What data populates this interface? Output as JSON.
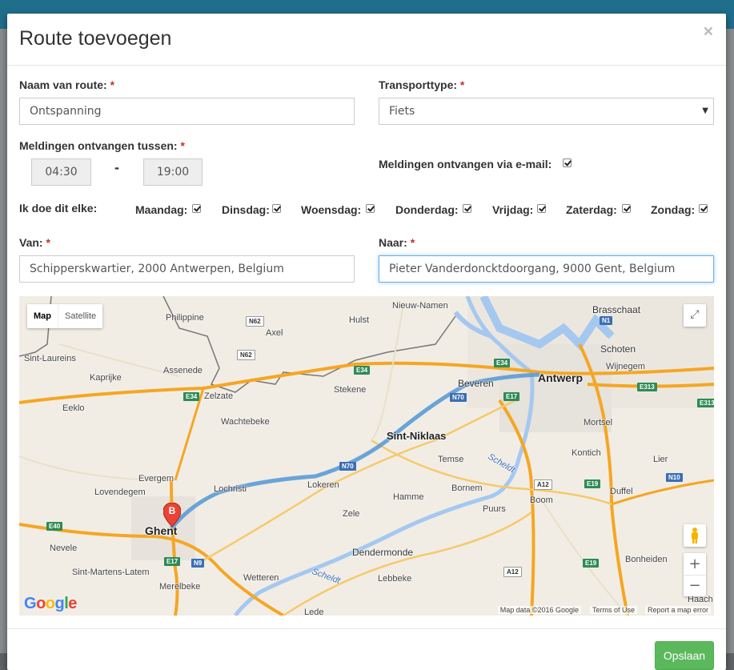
{
  "modal": {
    "title": "Route toevoegen",
    "close": "×"
  },
  "form": {
    "route_name_label": "Naam van route:",
    "route_name_value": "Ontspanning",
    "transport_label": "Transporttype:",
    "transport_value": "Fiets",
    "notif_between_label": "Meldingen ontvangen tussen:",
    "time_from": "04:30",
    "time_separator": "-",
    "time_to": "19:00",
    "notif_email_label": "Meldingen ontvangen via e-mail:",
    "notif_email_checked": true,
    "days_label": "Ik doe dit elke:",
    "days": [
      {
        "label": "Maandag:",
        "checked": true
      },
      {
        "label": "Dinsdag:",
        "checked": true
      },
      {
        "label": "Woensdag:",
        "checked": true
      },
      {
        "label": "Donderdag:",
        "checked": true
      },
      {
        "label": "Vrijdag:",
        "checked": true
      },
      {
        "label": "Zaterdag:",
        "checked": true
      },
      {
        "label": "Zondag:",
        "checked": true
      }
    ],
    "from_label": "Van:",
    "from_value": "Schipperskwartier, 2000 Antwerpen, Belgium",
    "to_label": "Naar:",
    "to_value": "Pieter Vanderdoncktdoorgang, 9000 Gent, Belgium",
    "required_mark": "*"
  },
  "map": {
    "map_type_map": "Map",
    "map_type_satellite": "Satellite",
    "marker_label": "B",
    "zoom_in": "+",
    "zoom_out": "−",
    "attribution_data": "Map data ©2016 Google",
    "attribution_terms": "Terms of Use",
    "attribution_report": "Report a map error",
    "logo": "Google",
    "places": {
      "nieuw_namen": "Nieuw-Namen",
      "brasschaat": "Brasschaat",
      "philippine": "Philippine",
      "hulst": "Hulst",
      "axel": "Axel",
      "schoten": "Schoten",
      "sint_laureins": "Sint-Laureins",
      "assenede": "Assenede",
      "kaprijke": "Kaprijke",
      "wijnegem": "Wijnegem",
      "antwerp": "Antwerp",
      "stekene": "Stekene",
      "beveren": "Beveren",
      "eeklo": "Eeklo",
      "zelzate": "Zelzate",
      "wachtebeke": "Wachtebeke",
      "mortsel": "Mortsel",
      "sint_niklaas": "Sint-Niklaas",
      "temse": "Temse",
      "kontich": "Kontich",
      "evergem": "Evergem",
      "lovendegem": "Lovendegem",
      "lochristi": "Lochristi",
      "lokeren": "Lokeren",
      "lier": "Lier",
      "scheldt1": "Scheldt",
      "bornem": "Bornem",
      "hamme": "Hamme",
      "boom": "Boom",
      "duffel": "Duffel",
      "puurs": "Puurs",
      "ghent": "Ghent",
      "zele": "Zele",
      "nevele": "Nevele",
      "dendermonde": "Dendermonde",
      "bonheiden": "Bonheiden",
      "sint_martens_latem": "Sint-Martens-Latem",
      "wetteren": "Wetteren",
      "lebbeke": "Lebbeke",
      "scheldt2": "Scheldt",
      "merelbeke": "Merelbeke",
      "lede": "Lede",
      "haacht": "Haach"
    },
    "roads": {
      "n62a": "N62",
      "n62b": "N62",
      "e34a": "E34",
      "e34b": "E34",
      "e34c": "E34",
      "n1": "N1",
      "e313a": "E313",
      "e313b": "E313",
      "n70a": "N70",
      "n70b": "N70",
      "e17a": "E17",
      "e17b": "E17",
      "a12a": "A12",
      "a12b": "A12",
      "n10": "N10",
      "e40": "E40",
      "n9": "N9",
      "e19a": "E19",
      "e19b": "E19"
    },
    "colors": {
      "route": "#5b9bd5",
      "highway": "#f5a623",
      "water": "#a5c8f0",
      "land": "#f1ede5"
    }
  },
  "footer": {
    "save_label": "Opslaan"
  }
}
